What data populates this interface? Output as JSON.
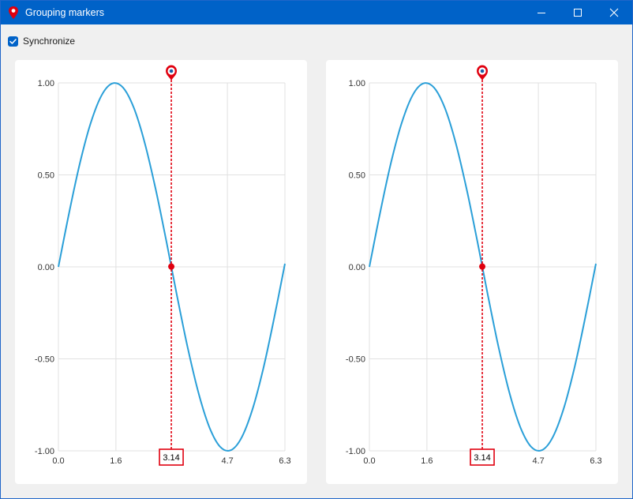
{
  "window": {
    "title": "Grouping markers",
    "controls": [
      "minimize",
      "maximize",
      "close"
    ]
  },
  "toolbar": {
    "synchronize_label": "Synchronize",
    "synchronize_checked": true
  },
  "colors": {
    "titlebar": "#0062c8",
    "series": "#2a9fd8",
    "marker": "#e0000f",
    "grid": "#e1e1e1"
  },
  "marker": {
    "x": 3.14,
    "label": "3.14",
    "icon": "location-pin-icon"
  },
  "chart_data": [
    {
      "type": "line",
      "function": "sin(x)",
      "x": [
        0,
        0.3,
        0.6,
        0.9,
        1.2,
        1.5,
        1.8,
        2.1,
        2.4,
        2.7,
        3.0,
        3.3,
        3.6,
        3.9,
        4.2,
        4.5,
        4.8,
        5.1,
        5.4,
        5.7,
        6.0,
        6.3
      ],
      "y": [
        0,
        0.296,
        0.565,
        0.783,
        0.932,
        0.997,
        0.974,
        0.863,
        0.675,
        0.427,
        0.141,
        -0.158,
        -0.443,
        -0.688,
        -0.872,
        -0.978,
        -0.996,
        -0.926,
        -0.773,
        -0.551,
        -0.279,
        0.017
      ],
      "xlim": [
        0,
        6.3
      ],
      "ylim": [
        -1,
        1
      ],
      "xticks": [
        "0.0",
        "1.6",
        "4.7",
        "6.3"
      ],
      "xtick_values": [
        0,
        1.6,
        4.7,
        6.3
      ],
      "yticks": [
        "1.00",
        "0.50",
        "0.00",
        "-0.50",
        "-1.00"
      ],
      "ytick_values": [
        1,
        0.5,
        0,
        -0.5,
        -1
      ],
      "grid": true
    },
    {
      "type": "line",
      "function": "sin(x)",
      "x": [
        0,
        0.3,
        0.6,
        0.9,
        1.2,
        1.5,
        1.8,
        2.1,
        2.4,
        2.7,
        3.0,
        3.3,
        3.6,
        3.9,
        4.2,
        4.5,
        4.8,
        5.1,
        5.4,
        5.7,
        6.0,
        6.3
      ],
      "y": [
        0,
        0.296,
        0.565,
        0.783,
        0.932,
        0.997,
        0.974,
        0.863,
        0.675,
        0.427,
        0.141,
        -0.158,
        -0.443,
        -0.688,
        -0.872,
        -0.978,
        -0.996,
        -0.926,
        -0.773,
        -0.551,
        -0.279,
        0.017
      ],
      "xlim": [
        0,
        6.3
      ],
      "ylim": [
        -1,
        1
      ],
      "xticks": [
        "0.0",
        "1.6",
        "4.7",
        "6.3"
      ],
      "xtick_values": [
        0,
        1.6,
        4.7,
        6.3
      ],
      "yticks": [
        "1.00",
        "0.50",
        "0.00",
        "-0.50",
        "-1.00"
      ],
      "ytick_values": [
        1,
        0.5,
        0,
        -0.5,
        -1
      ],
      "grid": true
    }
  ]
}
